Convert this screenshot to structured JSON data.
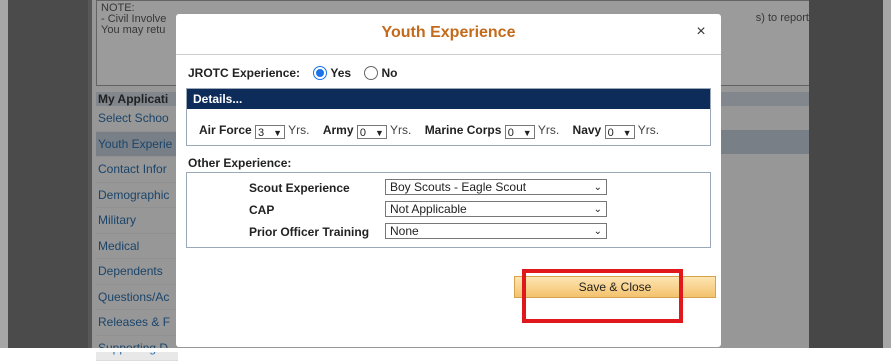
{
  "background": {
    "note_lines": [
      "NOTE:",
      "- Civil Involve",
      "You may retu"
    ],
    "note_right_text": "s) to report.",
    "app_header": "My Applicati",
    "app_items": [
      {
        "label": "Select Schoo",
        "active": false
      },
      {
        "label": "Youth Experie",
        "active": true
      },
      {
        "label": "Contact Infor",
        "active": false
      },
      {
        "label": "Demographic",
        "active": false
      },
      {
        "label": "Military",
        "active": false
      },
      {
        "label": "Medical",
        "active": false
      },
      {
        "label": "Dependents",
        "active": false
      },
      {
        "label": "Questions/Ac",
        "active": false
      },
      {
        "label": "Releases & F",
        "active": false
      },
      {
        "label": "Supporting D",
        "active": false
      }
    ]
  },
  "modal": {
    "title": "Youth Experience",
    "close_glyph": "×",
    "jrotc": {
      "label": "JROTC Experience:",
      "options": [
        {
          "label": "Yes",
          "selected": true
        },
        {
          "label": "No",
          "selected": false
        }
      ]
    },
    "details": {
      "header": "Details...",
      "fields": [
        {
          "label": "Air Force",
          "value": "3",
          "unit": "Yrs."
        },
        {
          "label": "Army",
          "value": "0",
          "unit": "Yrs."
        },
        {
          "label": "Marine Corps",
          "value": "0",
          "unit": "Yrs."
        },
        {
          "label": "Navy",
          "value": "0",
          "unit": "Yrs."
        }
      ]
    },
    "other": {
      "header": "Other Experience:",
      "rows": [
        {
          "label": "Scout Experience",
          "value": "Boy Scouts - Eagle Scout"
        },
        {
          "label": "CAP",
          "value": "Not Applicable"
        },
        {
          "label": "Prior Officer Training",
          "value": "None"
        }
      ]
    },
    "save_label": "Save & Close"
  },
  "colors": {
    "title": "#c46a1b",
    "details_header_bg": "#0e2c5a",
    "highlight": "#e0181c",
    "radio_selected": "#1a73e8"
  }
}
